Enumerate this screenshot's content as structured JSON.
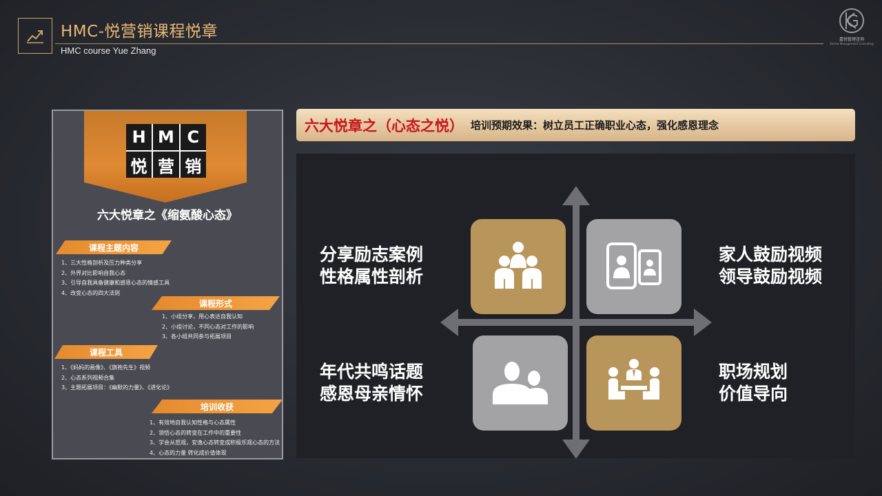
{
  "header": {
    "title": "HMC-悦营销课程悦章",
    "subtitle": "HMC course Yue Zhang",
    "brand_name": "嘉悦管理咨询",
    "brand_sub": "KaiYue Management Consulting"
  },
  "poster": {
    "logo_chars": [
      "H",
      "M",
      "C",
      "悦",
      "营",
      "销"
    ],
    "title": "六大悦章之《缩氨酸心态》",
    "sections": [
      {
        "heading": "课程主题内容",
        "items": [
          "1、三大性格剖析及压力种类分享",
          "2、外界对比影响自我心态",
          "3、引导自我具备健康和感恩心态的情感工具",
          "4、改变心态的四大法则"
        ]
      },
      {
        "heading": "课程形式",
        "items": [
          "1、小组分享，用心表达自我认知",
          "2、小组讨论，不同心态对工作的影响",
          "3、各小组共同参与拓展项目"
        ]
      },
      {
        "heading": "课程工具",
        "items": [
          "1、《妈妈的画像》、《旗袍先生》视频",
          "2、心态系列视频合集",
          "3、主题拓展项目：《幽默的力量》、《进化论》"
        ]
      },
      {
        "heading": "培训收获",
        "items": [
          "1、有效地自我认知性格与心态属性",
          "2、领悟心态的转变在工作中的重要性",
          "3、学会从怒观，安逸心态转变成积极乐观心态的方法",
          "4、心态的力量 转化成价值体现"
        ]
      }
    ]
  },
  "topbar": {
    "title": "六大悦章之（心态之悦）",
    "effect": "培训预期效果：树立员工正确职业心态，强化感恩理念"
  },
  "quadrants": {
    "top_left": {
      "line1": "分享励志案例",
      "line2": "性格属性剖析",
      "icon": "group-icon"
    },
    "top_right": {
      "line1": "家人鼓励视频",
      "line2": "领导鼓励视频",
      "icon": "video-call-icon"
    },
    "bottom_left": {
      "line1": "年代共鸣话题",
      "line2": "感恩母亲情怀",
      "icon": "two-people-icon"
    },
    "bottom_right": {
      "line1": "职场规划",
      "line2": "价值导向",
      "icon": "meeting-icon"
    }
  },
  "colors": {
    "gold": "#b8955a",
    "grey": "#a3a3a6",
    "accent": "#c9a86a",
    "red": "#c8151b"
  }
}
